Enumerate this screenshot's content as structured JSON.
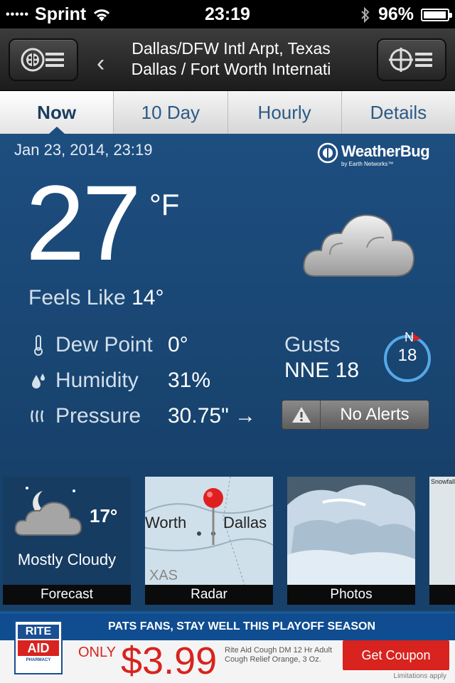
{
  "status_bar": {
    "carrier": "Sprint",
    "signal_dots": "•••••",
    "time": "23:19",
    "battery": "96%",
    "battery_level": 0.96
  },
  "nav": {
    "title_line1": "Dallas/DFW Intl Arpt, Texas",
    "title_line2": "Dallas / Fort Worth Internati",
    "back_glyph": "‹"
  },
  "tabs": [
    {
      "label": "Now",
      "active": true
    },
    {
      "label": "10 Day",
      "active": false
    },
    {
      "label": "Hourly",
      "active": false
    },
    {
      "label": "Details",
      "active": false
    }
  ],
  "now": {
    "date": "Jan 23, 2014, 23:19",
    "logo_name": "WeatherBug",
    "logo_sub": "by Earth Networks™",
    "temperature": "27",
    "unit": "°F",
    "feels_label": "Feels Like",
    "feels_value": "14°",
    "dew_point_label": "Dew Point",
    "dew_point_value": "0°",
    "humidity_label": "Humidity",
    "humidity_value": "31%",
    "pressure_label": "Pressure",
    "pressure_value": "30.75\" →",
    "gusts_label": "Gusts",
    "gusts_value": "NNE 18",
    "compass_north": "N",
    "compass_speed": "18",
    "alerts": "No Alerts"
  },
  "tiles": [
    {
      "caption": "Forecast",
      "temp": "17°",
      "condition": "Mostly Cloudy"
    },
    {
      "caption": "Radar",
      "map_label_left": "Worth",
      "map_label_right": "Dallas",
      "map_label_bottom": "XAS"
    },
    {
      "caption": "Photos"
    },
    {
      "caption": "",
      "corner_text": "Snowfall &"
    }
  ],
  "ad": {
    "headline": "PATS FANS, STAY WELL THIS PLAYOFF SEASON",
    "logo_top": "RITE",
    "logo_mid": "AID",
    "logo_bottom": "PHARMACY",
    "only": "ONLY",
    "price": "$3.99",
    "description": "Rite Aid Cough DM 12 Hr Adult Cough Relief Orange, 3 Oz.",
    "button": "Get Coupon",
    "fine_print": "Limitations apply"
  },
  "colors": {
    "panel_blue": "#1d4e80",
    "accent_red": "#d8231f",
    "compass_ring": "#56a8e6"
  }
}
